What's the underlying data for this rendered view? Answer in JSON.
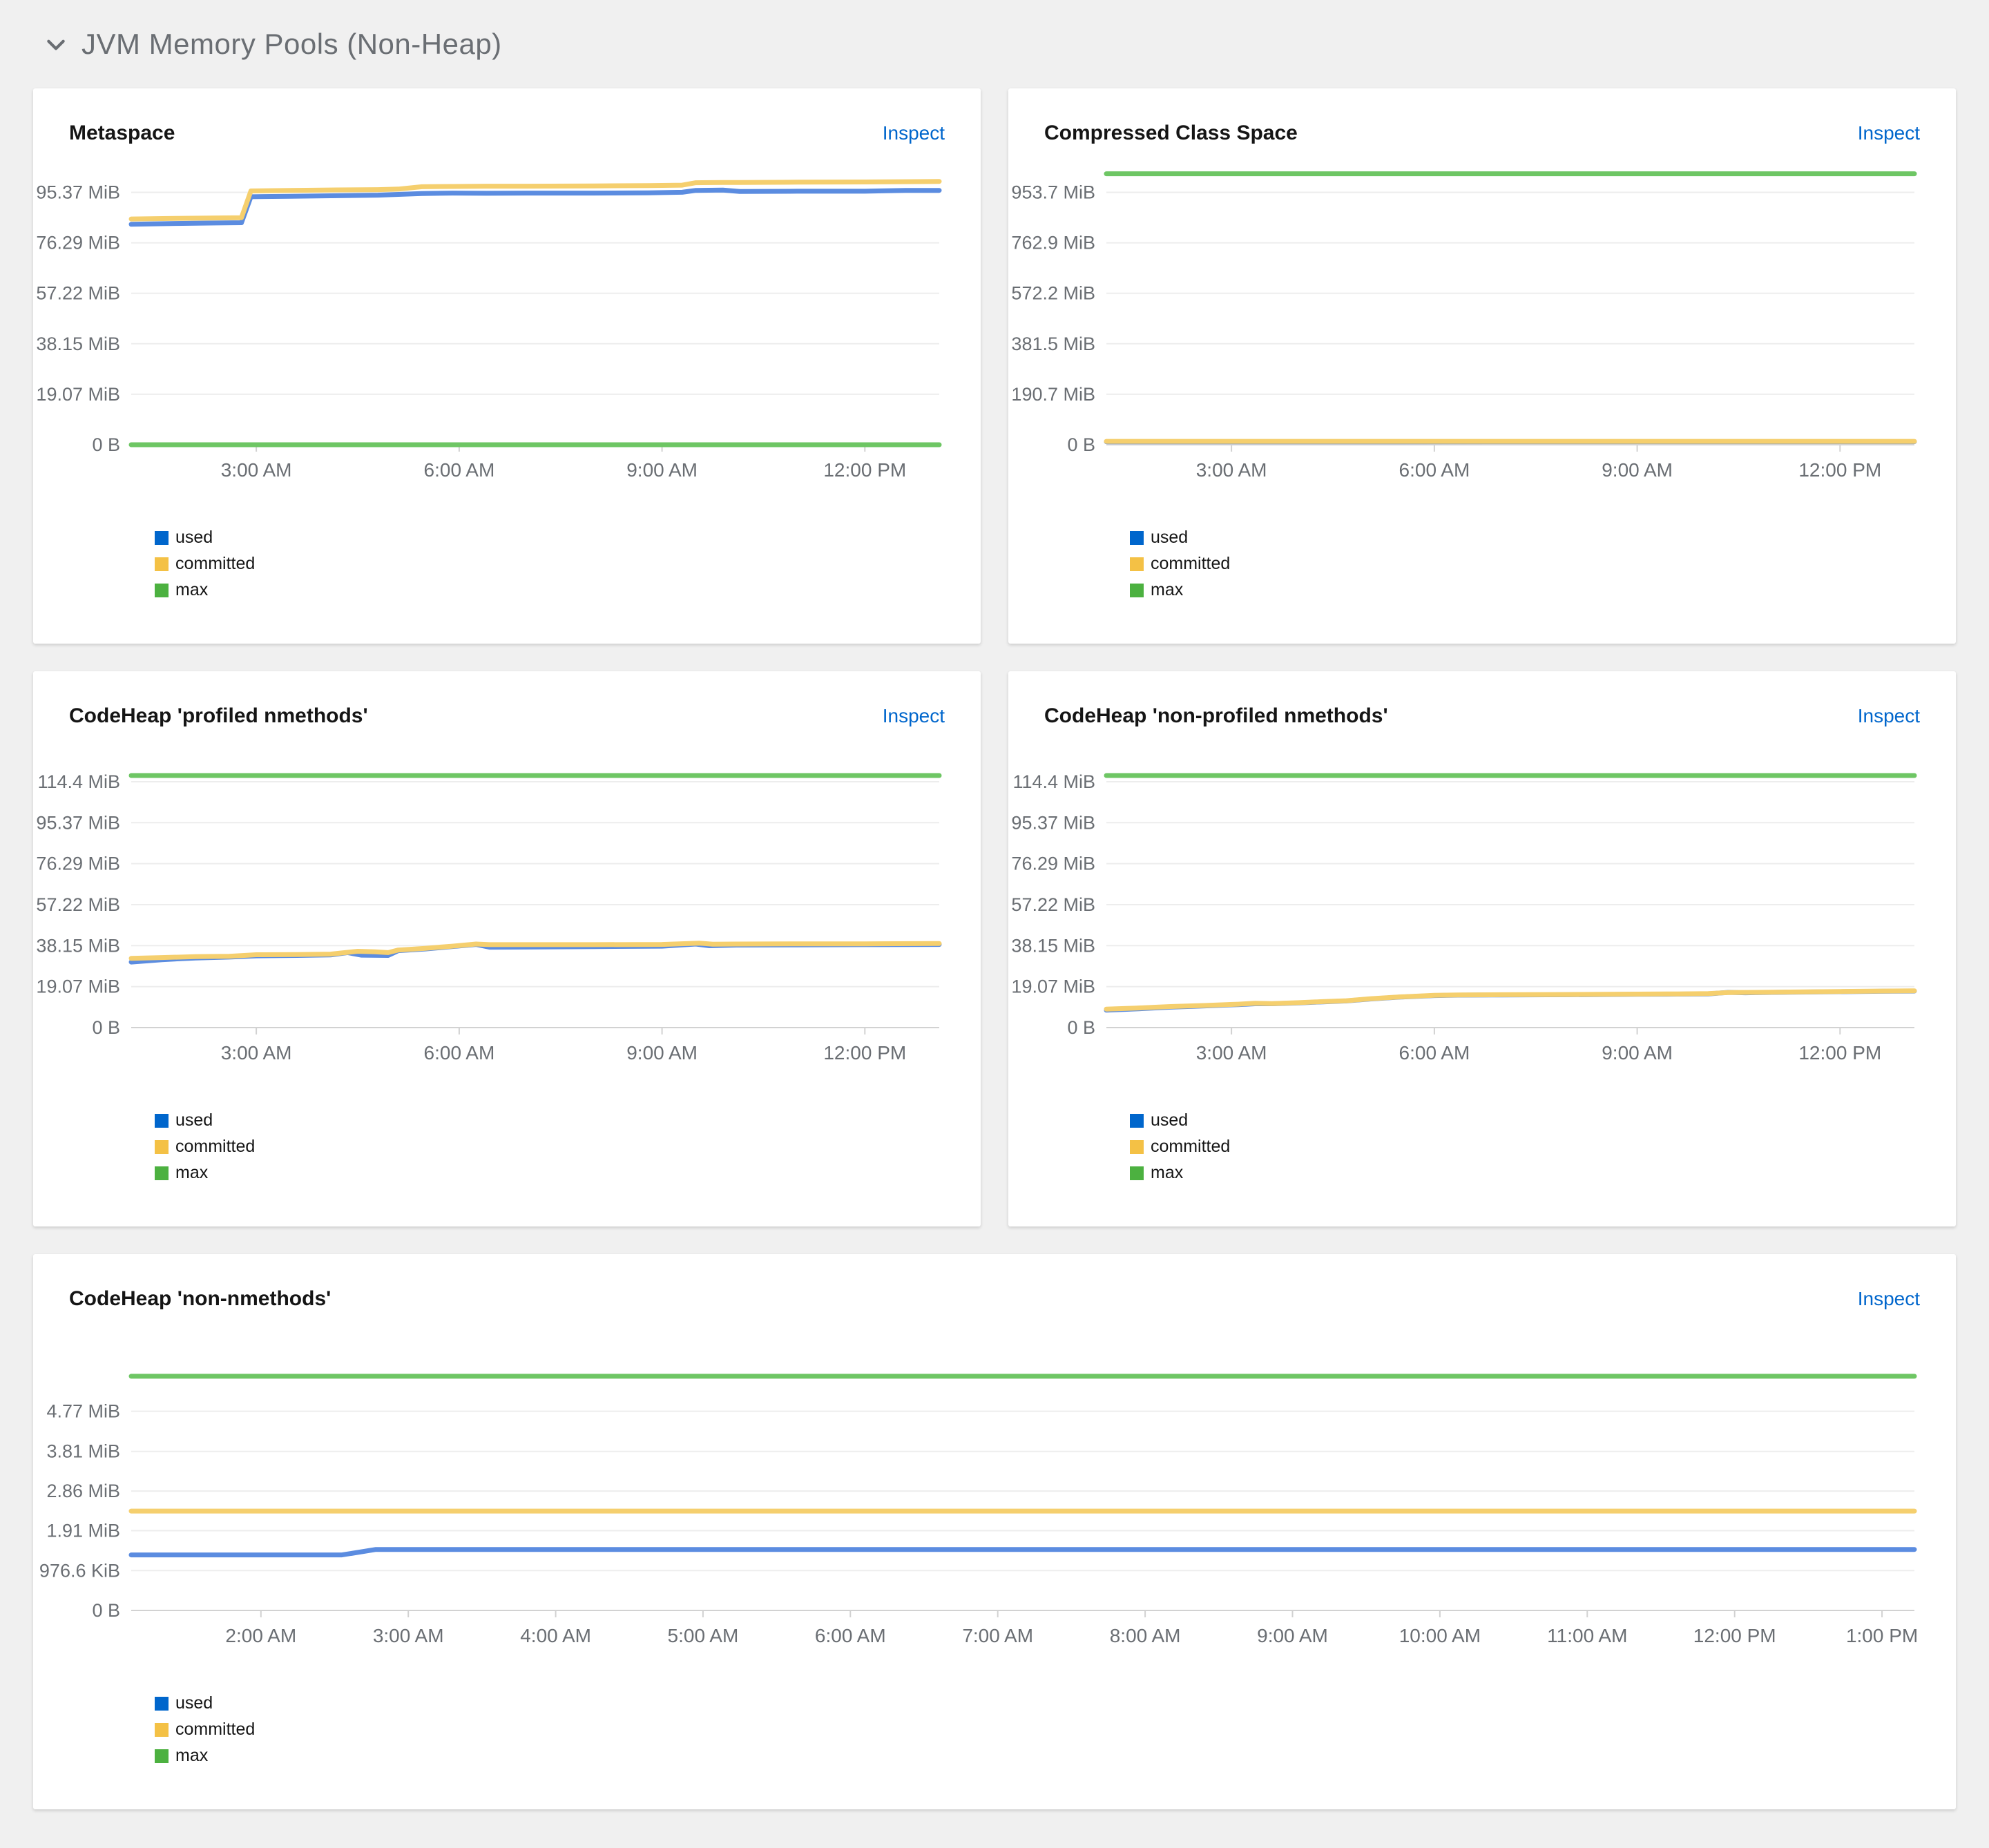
{
  "section": {
    "title": "JVM Memory Pools (Non-Heap)",
    "state": "expanded",
    "toggle_icon": "angle-down-icon"
  },
  "colors": {
    "page_background": "#f0f0f0",
    "card_background": "#ffffff",
    "inspect_link": "#0066cc",
    "axis_text": "#6a6e73",
    "grid_line": "#ededed",
    "axis_line": "#d2d2d2",
    "used_line": "#5b8ce0",
    "committed_line": "#f5cf6e",
    "max_line": "#6ec664",
    "used_swatch": "#0066cc",
    "committed_swatch": "#f4c145",
    "max_swatch": "#4cb140"
  },
  "chart_data": [
    {
      "type": "line",
      "title": "Metaspace",
      "inspect_label": "Inspect",
      "x_unit": "hour-of-day",
      "x_domain": [
        1.15,
        13.1
      ],
      "y_domain": [
        0,
        104.9
      ],
      "x_ticks": [
        {
          "label": "3:00 AM",
          "v": 3
        },
        {
          "label": "6:00 AM",
          "v": 6
        },
        {
          "label": "9:00 AM",
          "v": 9
        },
        {
          "label": "12:00 PM",
          "v": 12
        }
      ],
      "y_ticks": [
        {
          "label": "95.37 MiB",
          "v": 95.37
        },
        {
          "label": "76.29 MiB",
          "v": 76.29
        },
        {
          "label": "57.22 MiB",
          "v": 57.22
        },
        {
          "label": "38.15 MiB",
          "v": 38.15
        },
        {
          "label": "19.07 MiB",
          "v": 19.07
        },
        {
          "label": "0 B",
          "v": 0
        }
      ],
      "series": [
        {
          "name": "used",
          "line_color": "#5b8ce0",
          "swatch_color": "#0066cc",
          "points": [
            [
              1.15,
              83.3
            ],
            [
              1.8,
              83.6
            ],
            [
              2.4,
              83.8
            ],
            [
              2.78,
              83.9
            ],
            [
              2.92,
              93.7
            ],
            [
              3.5,
              93.9
            ],
            [
              4.2,
              94.1
            ],
            [
              4.8,
              94.3
            ],
            [
              5.1,
              94.6
            ],
            [
              5.45,
              94.9
            ],
            [
              5.9,
              95.1
            ],
            [
              6.4,
              95.0
            ],
            [
              7.0,
              95.1
            ],
            [
              8.0,
              95.1
            ],
            [
              8.8,
              95.2
            ],
            [
              9.3,
              95.4
            ],
            [
              9.5,
              96.1
            ],
            [
              9.9,
              96.2
            ],
            [
              10.15,
              95.7
            ],
            [
              11.0,
              95.8
            ],
            [
              12.0,
              95.8
            ],
            [
              12.6,
              96.1
            ],
            [
              13.1,
              96.1
            ]
          ]
        },
        {
          "name": "committed",
          "line_color": "#f5cf6e",
          "swatch_color": "#f4c145",
          "points": [
            [
              1.15,
              85.3
            ],
            [
              1.8,
              85.5
            ],
            [
              2.4,
              85.7
            ],
            [
              2.78,
              85.8
            ],
            [
              2.92,
              95.9
            ],
            [
              3.5,
              96.1
            ],
            [
              4.2,
              96.3
            ],
            [
              4.8,
              96.4
            ],
            [
              5.1,
              96.6
            ],
            [
              5.45,
              97.5
            ],
            [
              5.9,
              97.6
            ],
            [
              6.4,
              97.7
            ],
            [
              7.0,
              97.7
            ],
            [
              8.0,
              97.8
            ],
            [
              8.8,
              97.9
            ],
            [
              9.3,
              98.1
            ],
            [
              9.5,
              99.0
            ],
            [
              9.9,
              99.1
            ],
            [
              10.15,
              99.1
            ],
            [
              11.0,
              99.2
            ],
            [
              12.0,
              99.3
            ],
            [
              12.6,
              99.4
            ],
            [
              13.1,
              99.5
            ]
          ]
        },
        {
          "name": "max",
          "line_color": "#6ec664",
          "swatch_color": "#4cb140",
          "points": [
            [
              1.15,
              0
            ],
            [
              13.1,
              0
            ]
          ]
        }
      ]
    },
    {
      "type": "line",
      "title": "Compressed Class Space",
      "inspect_label": "Inspect",
      "x_unit": "hour-of-day",
      "x_domain": [
        1.15,
        13.1
      ],
      "y_domain": [
        0,
        1049
      ],
      "x_ticks": [
        {
          "label": "3:00 AM",
          "v": 3
        },
        {
          "label": "6:00 AM",
          "v": 6
        },
        {
          "label": "9:00 AM",
          "v": 9
        },
        {
          "label": "12:00 PM",
          "v": 12
        }
      ],
      "y_ticks": [
        {
          "label": "953.7 MiB",
          "v": 953.7
        },
        {
          "label": "762.9 MiB",
          "v": 762.9
        },
        {
          "label": "572.2 MiB",
          "v": 572.2
        },
        {
          "label": "381.5 MiB",
          "v": 381.5
        },
        {
          "label": "190.7 MiB",
          "v": 190.7
        },
        {
          "label": "0 B",
          "v": 0
        }
      ],
      "series": [
        {
          "name": "used",
          "line_color": "#5b8ce0",
          "swatch_color": "#0066cc",
          "points": [
            [
              1.15,
              11.6
            ],
            [
              13.1,
              11.7
            ]
          ]
        },
        {
          "name": "committed",
          "line_color": "#f5cf6e",
          "swatch_color": "#f4c145",
          "points": [
            [
              1.15,
              12.8
            ],
            [
              13.1,
              12.9
            ]
          ]
        },
        {
          "name": "max",
          "line_color": "#6ec664",
          "swatch_color": "#4cb140",
          "points": [
            [
              1.15,
              1024
            ],
            [
              13.1,
              1024
            ]
          ]
        }
      ]
    },
    {
      "type": "line",
      "title": "CodeHeap 'profiled nmethods'",
      "inspect_label": "Inspect",
      "x_unit": "hour-of-day",
      "x_domain": [
        1.15,
        13.1
      ],
      "y_domain": [
        0,
        129.2
      ],
      "x_ticks": [
        {
          "label": "3:00 AM",
          "v": 3
        },
        {
          "label": "6:00 AM",
          "v": 6
        },
        {
          "label": "9:00 AM",
          "v": 9
        },
        {
          "label": "12:00 PM",
          "v": 12
        }
      ],
      "y_ticks": [
        {
          "label": "114.4 MiB",
          "v": 114.4
        },
        {
          "label": "95.37 MiB",
          "v": 95.37
        },
        {
          "label": "76.29 MiB",
          "v": 76.29
        },
        {
          "label": "57.22 MiB",
          "v": 57.22
        },
        {
          "label": "38.15 MiB",
          "v": 38.15
        },
        {
          "label": "19.07 MiB",
          "v": 19.07
        },
        {
          "label": "0 B",
          "v": 0
        }
      ],
      "series": [
        {
          "name": "used",
          "line_color": "#5b8ce0",
          "swatch_color": "#0066cc",
          "points": [
            [
              1.15,
              30.5
            ],
            [
              1.6,
              31.6
            ],
            [
              2.1,
              32.4
            ],
            [
              2.6,
              32.8
            ],
            [
              3.0,
              33.4
            ],
            [
              3.6,
              33.6
            ],
            [
              4.1,
              33.8
            ],
            [
              4.35,
              34.9
            ],
            [
              4.55,
              33.7
            ],
            [
              4.95,
              33.6
            ],
            [
              5.1,
              35.8
            ],
            [
              5.5,
              36.6
            ],
            [
              5.9,
              37.7
            ],
            [
              6.25,
              38.7
            ],
            [
              6.45,
              37.4
            ],
            [
              7.2,
              37.5
            ],
            [
              8.0,
              37.7
            ],
            [
              9.0,
              37.9
            ],
            [
              9.5,
              38.9
            ],
            [
              9.7,
              38.1
            ],
            [
              10.1,
              38.4
            ],
            [
              11.0,
              38.5
            ],
            [
              12.0,
              38.6
            ],
            [
              13.1,
              38.7
            ]
          ]
        },
        {
          "name": "committed",
          "line_color": "#f5cf6e",
          "swatch_color": "#f4c145",
          "points": [
            [
              1.15,
              32.2
            ],
            [
              1.6,
              32.6
            ],
            [
              2.1,
              33.0
            ],
            [
              2.6,
              33.2
            ],
            [
              3.0,
              33.9
            ],
            [
              3.6,
              34.0
            ],
            [
              4.1,
              34.2
            ],
            [
              4.5,
              35.5
            ],
            [
              4.75,
              35.3
            ],
            [
              4.95,
              34.9
            ],
            [
              5.1,
              36.1
            ],
            [
              5.5,
              36.9
            ],
            [
              5.9,
              37.9
            ],
            [
              6.25,
              38.9
            ],
            [
              6.45,
              38.6
            ],
            [
              7.2,
              38.6
            ],
            [
              8.0,
              38.6
            ],
            [
              9.0,
              38.7
            ],
            [
              9.55,
              39.3
            ],
            [
              9.75,
              38.8
            ],
            [
              10.1,
              38.9
            ],
            [
              11.0,
              39.0
            ],
            [
              12.0,
              39.0
            ],
            [
              13.1,
              39.1
            ]
          ]
        },
        {
          "name": "max",
          "line_color": "#6ec664",
          "swatch_color": "#4cb140",
          "points": [
            [
              1.15,
              117.3
            ],
            [
              13.1,
              117.3
            ]
          ]
        }
      ]
    },
    {
      "type": "line",
      "title": "CodeHeap 'non-profiled nmethods'",
      "inspect_label": "Inspect",
      "x_unit": "hour-of-day",
      "x_domain": [
        1.15,
        13.1
      ],
      "y_domain": [
        0,
        129.2
      ],
      "x_ticks": [
        {
          "label": "3:00 AM",
          "v": 3
        },
        {
          "label": "6:00 AM",
          "v": 6
        },
        {
          "label": "9:00 AM",
          "v": 9
        },
        {
          "label": "12:00 PM",
          "v": 12
        }
      ],
      "y_ticks": [
        {
          "label": "114.4 MiB",
          "v": 114.4
        },
        {
          "label": "95.37 MiB",
          "v": 95.37
        },
        {
          "label": "76.29 MiB",
          "v": 76.29
        },
        {
          "label": "57.22 MiB",
          "v": 57.22
        },
        {
          "label": "38.15 MiB",
          "v": 38.15
        },
        {
          "label": "19.07 MiB",
          "v": 19.07
        },
        {
          "label": "0 B",
          "v": 0
        }
      ],
      "series": [
        {
          "name": "used",
          "line_color": "#5b8ce0",
          "swatch_color": "#0066cc",
          "points": [
            [
              1.15,
              8.1
            ],
            [
              1.6,
              8.7
            ],
            [
              2.1,
              9.5
            ],
            [
              2.6,
              10.1
            ],
            [
              3.1,
              10.7
            ],
            [
              3.35,
              11.1
            ],
            [
              3.6,
              11.1
            ],
            [
              4.0,
              11.5
            ],
            [
              4.35,
              12.0
            ],
            [
              4.7,
              12.4
            ],
            [
              5.05,
              13.3
            ],
            [
              5.5,
              14.2
            ],
            [
              6.0,
              14.9
            ],
            [
              6.35,
              15.1
            ],
            [
              7.0,
              15.2
            ],
            [
              8.0,
              15.3
            ],
            [
              9.0,
              15.5
            ],
            [
              9.6,
              15.6
            ],
            [
              10.05,
              15.7
            ],
            [
              10.35,
              16.4
            ],
            [
              10.6,
              16.2
            ],
            [
              11.0,
              16.4
            ],
            [
              12.0,
              16.7
            ],
            [
              12.6,
              16.9
            ],
            [
              13.1,
              17.0
            ]
          ]
        },
        {
          "name": "committed",
          "line_color": "#f5cf6e",
          "swatch_color": "#f4c145",
          "points": [
            [
              1.15,
              8.6
            ],
            [
              1.6,
              9.1
            ],
            [
              2.1,
              9.8
            ],
            [
              2.6,
              10.3
            ],
            [
              3.1,
              10.9
            ],
            [
              3.35,
              11.3
            ],
            [
              3.6,
              11.2
            ],
            [
              4.0,
              11.6
            ],
            [
              4.35,
              12.1
            ],
            [
              4.7,
              12.5
            ],
            [
              5.05,
              13.4
            ],
            [
              5.5,
              14.3
            ],
            [
              6.0,
              15.0
            ],
            [
              6.35,
              15.2
            ],
            [
              7.0,
              15.3
            ],
            [
              8.0,
              15.4
            ],
            [
              9.0,
              15.6
            ],
            [
              9.6,
              15.7
            ],
            [
              10.05,
              15.8
            ],
            [
              10.35,
              16.3
            ],
            [
              11.0,
              16.5
            ],
            [
              12.0,
              16.8
            ],
            [
              12.6,
              17.0
            ],
            [
              13.1,
              17.1
            ]
          ]
        },
        {
          "name": "max",
          "line_color": "#6ec664",
          "swatch_color": "#4cb140",
          "points": [
            [
              1.15,
              117.3
            ],
            [
              13.1,
              117.3
            ]
          ]
        }
      ]
    },
    {
      "type": "line",
      "title": "CodeHeap 'non-nmethods'",
      "inspect_label": "Inspect",
      "x_unit": "hour-of-day",
      "x_domain": [
        1.12,
        13.22
      ],
      "y_domain": [
        0,
        6.65
      ],
      "x_ticks": [
        {
          "label": "2:00 AM",
          "v": 2
        },
        {
          "label": "3:00 AM",
          "v": 3
        },
        {
          "label": "4:00 AM",
          "v": 4
        },
        {
          "label": "5:00 AM",
          "v": 5
        },
        {
          "label": "6:00 AM",
          "v": 6
        },
        {
          "label": "7:00 AM",
          "v": 7
        },
        {
          "label": "8:00 AM",
          "v": 8
        },
        {
          "label": "9:00 AM",
          "v": 9
        },
        {
          "label": "10:00 AM",
          "v": 10
        },
        {
          "label": "11:00 AM",
          "v": 11
        },
        {
          "label": "12:00 PM",
          "v": 12
        },
        {
          "label": "1:00 PM",
          "v": 13
        }
      ],
      "y_ticks": [
        {
          "label": "4.77 MiB",
          "v": 4.77
        },
        {
          "label": "3.81 MiB",
          "v": 3.81
        },
        {
          "label": "2.86 MiB",
          "v": 2.86
        },
        {
          "label": "1.91 MiB",
          "v": 1.91
        },
        {
          "label": "976.6 KiB",
          "v": 0.9537
        },
        {
          "label": "0 B",
          "v": 0
        }
      ],
      "series": [
        {
          "name": "used",
          "line_color": "#5b8ce0",
          "swatch_color": "#0066cc",
          "points": [
            [
              1.12,
              1.33
            ],
            [
              2.55,
              1.33
            ],
            [
              2.78,
              1.46
            ],
            [
              13.22,
              1.46
            ]
          ]
        },
        {
          "name": "committed",
          "line_color": "#f5cf6e",
          "swatch_color": "#f4c145",
          "points": [
            [
              1.12,
              2.38
            ],
            [
              13.22,
              2.38
            ]
          ]
        },
        {
          "name": "max",
          "line_color": "#6ec664",
          "swatch_color": "#4cb140",
          "points": [
            [
              1.12,
              5.61
            ],
            [
              13.22,
              5.61
            ]
          ]
        }
      ]
    }
  ]
}
